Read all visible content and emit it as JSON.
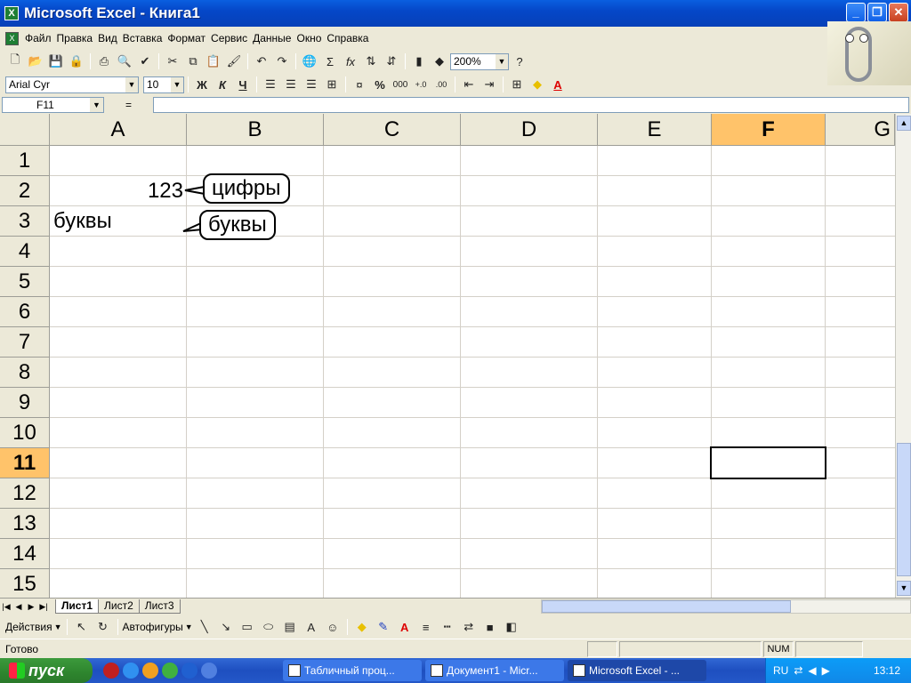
{
  "window": {
    "title": "Microsoft Excel - Книга1"
  },
  "menu": {
    "items": [
      "Файл",
      "Правка",
      "Вид",
      "Вставка",
      "Формат",
      "Сервис",
      "Данные",
      "Окно",
      "Справка"
    ]
  },
  "toolbar": {
    "zoom": "200%"
  },
  "format_toolbar": {
    "font": "Arial Cyr",
    "size": "10",
    "bold": "Ж",
    "italic": "К",
    "underline": "Ч",
    "percent": "%",
    "thousands": "000"
  },
  "formula_bar": {
    "name_box": "F11",
    "equals": "=",
    "value": ""
  },
  "sheet": {
    "columns": [
      "A",
      "B",
      "C",
      "D",
      "E",
      "F",
      "G"
    ],
    "rows": [
      "1",
      "2",
      "3",
      "4",
      "5",
      "6",
      "7",
      "8",
      "9",
      "10",
      "11",
      "12",
      "13",
      "14",
      "15"
    ],
    "selected_column": "F",
    "selected_row": "11",
    "cells": {
      "b2": "123",
      "a3": "буквы"
    },
    "callouts": {
      "digits": "цифры",
      "letters": "буквы"
    }
  },
  "sheet_tabs": [
    "Лист1",
    "Лист2",
    "Лист3"
  ],
  "drawing_toolbar": {
    "actions": "Действия",
    "autoshapes": "Автофигуры"
  },
  "status": {
    "ready": "Готово",
    "num": "NUM"
  },
  "taskbar": {
    "start": "пуск",
    "tasks": [
      "Табличный проц...",
      "Документ1 - Micr...",
      "Microsoft Excel - ..."
    ],
    "lang": "RU",
    "clock": "13:12"
  }
}
